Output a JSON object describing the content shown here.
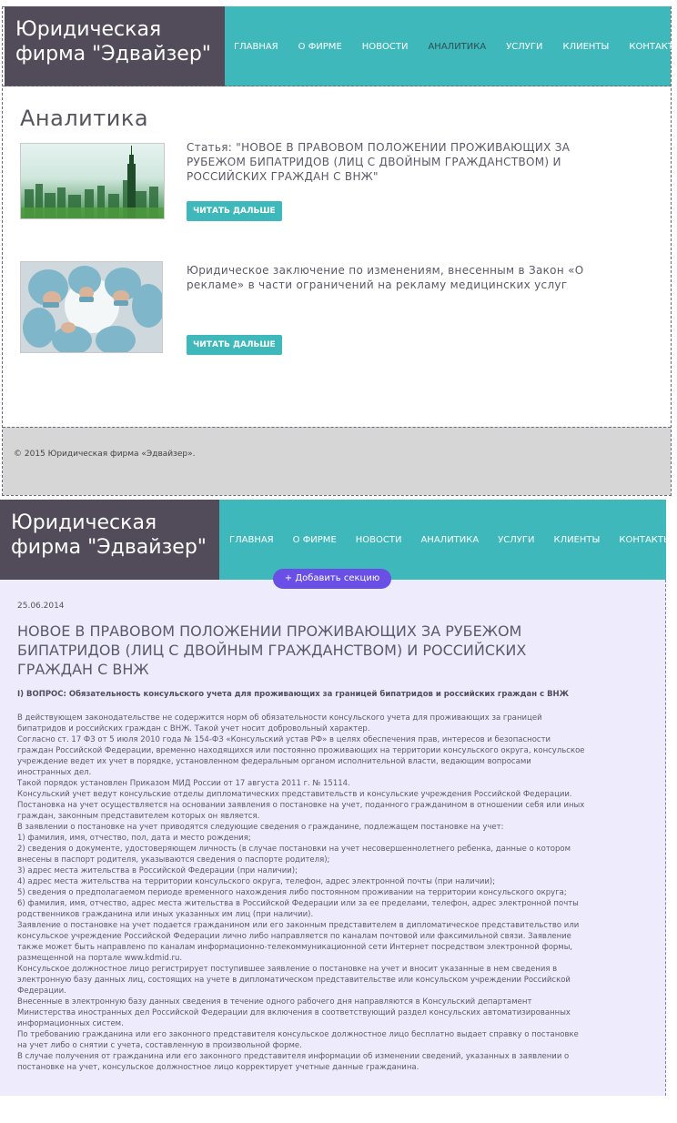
{
  "brand": {
    "title": "Юридическая фирма \"Эдвайзер\""
  },
  "nav": {
    "items": [
      "Главная",
      "О фирме",
      "Новости",
      "Аналитика",
      "Услуги",
      "Клиенты",
      "Контакты"
    ]
  },
  "analytics": {
    "title": "Аналитика",
    "read_more": "Читать дальше",
    "cards": [
      {
        "text": "Статья: \"НОВОЕ В ПРАВОВОМ ПОЛОЖЕНИИ ПРОЖИВАЮЩИХ ЗА РУБЕЖОМ БИПАТРИДОВ (ЛИЦ С ДВОЙНЫМ ГРАЖДАНСТВОМ) И РОССИЙСКИХ ГРАЖДАН С ВНЖ\"",
        "image": "city-skyline-image"
      },
      {
        "text": "Юридическое заключение по изменениям, внесенным в Закон «О рекламе» в части ограничений на рекламу медицинских услуг",
        "image": "surgeons-image"
      }
    ]
  },
  "footer": {
    "text": "© 2015 Юридическая фирма «Эдвайзер»."
  },
  "editor": {
    "add_section": "Добавить секцию",
    "add_icon": "+"
  },
  "article": {
    "date": "25.06.2014",
    "title": "НОВОЕ В ПРАВОВОМ ПОЛОЖЕНИИ ПРОЖИВАЮЩИХ ЗА РУБЕЖОМ БИПАТРИДОВ (ЛИЦ С ДВОЙНЫМ ГРАЖДАНСТВОМ) И РОССИЙСКИХ ГРАЖДАН С ВНЖ",
    "question": "I) ВОПРОС: Обязательность консульского учета для проживающих за границей бипатридов и российских граждан с ВНЖ",
    "paragraphs": [
      "В действующем законодательстве не содержится норм об обязательности консульского учета для проживающих за границей бипатридов и российских граждан с ВНЖ. Такой учет носит добровольный характер.",
      "Согласно ст. 17 ФЗ от 5 июля 2010 года № 154-ФЗ «Консульский устав РФ» в целях обеспечения прав, интересов и безопасности граждан Российской Федерации, временно находящихся или постоянно проживающих на территории консульского округа, консульское учреждение ведет их учет в порядке, установленном федеральным органом исполнительной власти, ведающим вопросами иностранных дел.",
      "Такой порядок установлен Приказом МИД России от 17 августа 2011 г. № 15114.",
      "Консульский учет ведут консульские отделы дипломатических представительств и консульские учреждения Российской Федерации.",
      "Постановка на учет осуществляется на основании заявления о постановке на учет, поданного гражданином в отношении себя или иных граждан, законным представителем которых он является.",
      "В заявлении о постановке на учет приводятся следующие сведения о гражданине, подлежащем постановке на учет:",
      "1) фамилия, имя, отчество, пол, дата и место рождения;",
      "2) сведения о документе, удостоверяющем личность (в случае постановки на учет несовершеннолетнего ребенка, данные о котором внесены в паспорт родителя, указываются сведения о паспорте родителя);",
      "3) адрес места жительства в Российской Федерации (при наличии);",
      "4) адрес места жительства на территории консульского округа, телефон, адрес электронной почты (при наличии);",
      "5) сведения о предполагаемом периоде временного нахождения либо постоянном проживании на территории консульского округа;",
      "6) фамилия, имя, отчество, адрес места жительства в Российской Федерации или за ее пределами, телефон, адрес электронной почты родственников гражданина или иных указанных им лиц (при наличии).",
      "Заявление о постановке на учет подается гражданином или его законным представителем в дипломатическое представительство или консульское учреждение Российской Федерации лично либо направляется по каналам почтовой или факсимильной связи. Заявление также может быть направлено по каналам информационно-телекоммуникационной сети Интернет посредством электронной формы, размещенной на портале www.kdmid.ru.",
      "Консульское должностное лицо регистрирует поступившее заявление о постановке на учет и вносит указанные в нем сведения в электронную базу данных лиц, состоящих на учете в дипломатическом представительстве или консульском учреждении Российской Федерации.",
      "Внесенные в электронную базу данных сведения в течение одного рабочего дня направляются в Консульский департамент Министерства иностранных дел Российской Федерации для включения в соответствующий раздел консульских автоматизированных информационных систем.",
      "По требованию гражданина или его законного представителя консульское должностное лицо бесплатно выдает справку о постановке на учет либо о снятии с учета, составленную в произвольной форме.",
      "В случае получения от гражданина или его законного представителя информации об изменении сведений, указанных в заявлении о постановке на учет, консульское должностное лицо корректирует учетные данные гражданина."
    ]
  }
}
